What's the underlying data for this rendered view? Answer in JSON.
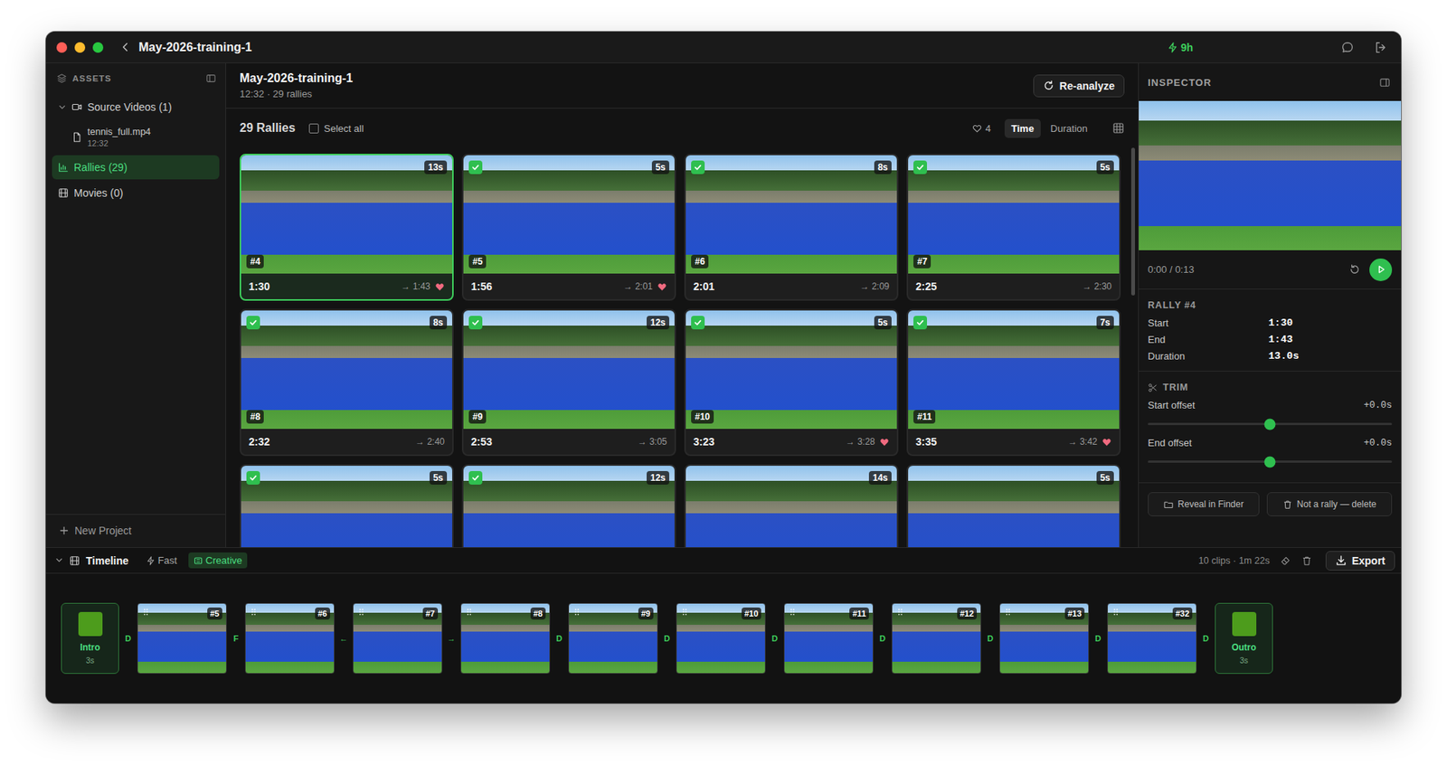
{
  "window": {
    "title": "May-2026-training-1",
    "credits": "9h"
  },
  "sidebar": {
    "header": "ASSETS",
    "items": [
      {
        "label": "Source Videos (1)",
        "kind": "folder",
        "expanded": true,
        "selected": false
      },
      {
        "label": "tennis_full.mp4",
        "sub": "12:32",
        "kind": "file",
        "selected": false
      },
      {
        "label": "Rallies (29)",
        "kind": "rallies",
        "selected": true
      },
      {
        "label": "Movies (0)",
        "kind": "movies",
        "selected": false
      }
    ],
    "new_project": "New Project"
  },
  "project": {
    "title": "May-2026-training-1",
    "subtitle": "12:32 · 29 rallies",
    "reanalyze": "Re-analyze"
  },
  "toolbar": {
    "count": "29 Rallies",
    "select_all": {
      "label": "Select all",
      "checked": false
    },
    "favorites": "4",
    "sort": [
      {
        "label": "Time",
        "selected": true
      },
      {
        "label": "Duration",
        "selected": false
      }
    ]
  },
  "rallies": [
    {
      "number": "#4",
      "badge": "13s",
      "start": "1:30",
      "end": "→ 1:43",
      "favorite": true,
      "checked": false,
      "selected": true
    },
    {
      "number": "#5",
      "badge": "5s",
      "start": "1:56",
      "end": "→ 2:01",
      "favorite": true,
      "checked": true,
      "selected": false
    },
    {
      "number": "#6",
      "badge": "8s",
      "start": "2:01",
      "end": "→ 2:09",
      "favorite": false,
      "checked": true,
      "selected": false
    },
    {
      "number": "#7",
      "badge": "5s",
      "start": "2:25",
      "end": "→ 2:30",
      "favorite": false,
      "checked": true,
      "selected": false
    },
    {
      "number": "#8",
      "badge": "8s",
      "start": "2:32",
      "end": "→ 2:40",
      "favorite": false,
      "checked": true,
      "selected": false
    },
    {
      "number": "#9",
      "badge": "12s",
      "start": "2:53",
      "end": "→ 3:05",
      "favorite": false,
      "checked": true,
      "selected": false
    },
    {
      "number": "#10",
      "badge": "5s",
      "start": "3:23",
      "end": "→ 3:28",
      "favorite": true,
      "checked": true,
      "selected": false
    },
    {
      "number": "#11",
      "badge": "7s",
      "start": "3:35",
      "end": "→ 3:42",
      "favorite": true,
      "checked": true,
      "selected": false
    },
    {
      "badge": "5s",
      "checked": true,
      "selected": false,
      "favorite": false
    },
    {
      "badge": "12s",
      "checked": true,
      "selected": false,
      "favorite": false
    },
    {
      "badge": "14s",
      "checked": false,
      "selected": false,
      "favorite": false
    },
    {
      "badge": "5s",
      "checked": false,
      "selected": false,
      "favorite": false
    }
  ],
  "inspector": {
    "title": "INSPECTOR",
    "time": "0:00 / 0:13",
    "rally": {
      "heading": "RALLY #4",
      "fields": [
        {
          "label": "Start",
          "value": "1:30"
        },
        {
          "label": "End",
          "value": "1:43"
        },
        {
          "label": "Duration",
          "value": "13.0s"
        }
      ]
    },
    "trim": {
      "heading": "TRIM",
      "sliders": [
        {
          "label": "Start offset",
          "value": "+0.0s",
          "level": 0.5
        },
        {
          "label": "End offset",
          "value": "+0.0s",
          "level": 0.5
        }
      ]
    },
    "buttons": [
      {
        "label": "Reveal in Finder",
        "kind": "reveal"
      },
      {
        "label": "Not a rally — delete",
        "kind": "delete"
      }
    ]
  },
  "timeline": {
    "label": "Timeline",
    "modes": [
      {
        "label": "Fast",
        "selected": false
      },
      {
        "label": "Creative",
        "selected": true
      }
    ],
    "summary": "10 clips · 1m 22s",
    "export": "Export",
    "items": [
      {
        "kind": "bookend",
        "label": "Intro",
        "duration": "3s"
      },
      {
        "kind": "clip",
        "number": "#5"
      },
      {
        "kind": "clip",
        "number": "#6"
      },
      {
        "kind": "clip",
        "number": "#7"
      },
      {
        "kind": "clip",
        "number": "#8"
      },
      {
        "kind": "clip",
        "number": "#9"
      },
      {
        "kind": "clip",
        "number": "#10"
      },
      {
        "kind": "clip",
        "number": "#11"
      },
      {
        "kind": "clip",
        "number": "#12"
      },
      {
        "kind": "clip",
        "number": "#13"
      },
      {
        "kind": "clip",
        "number": "#32"
      },
      {
        "kind": "bookend",
        "label": "Outro",
        "duration": "3s"
      }
    ],
    "transitions": [
      "D",
      "F",
      "←",
      "→",
      "D",
      "D",
      "D",
      "D",
      "D",
      "D",
      "D"
    ]
  }
}
